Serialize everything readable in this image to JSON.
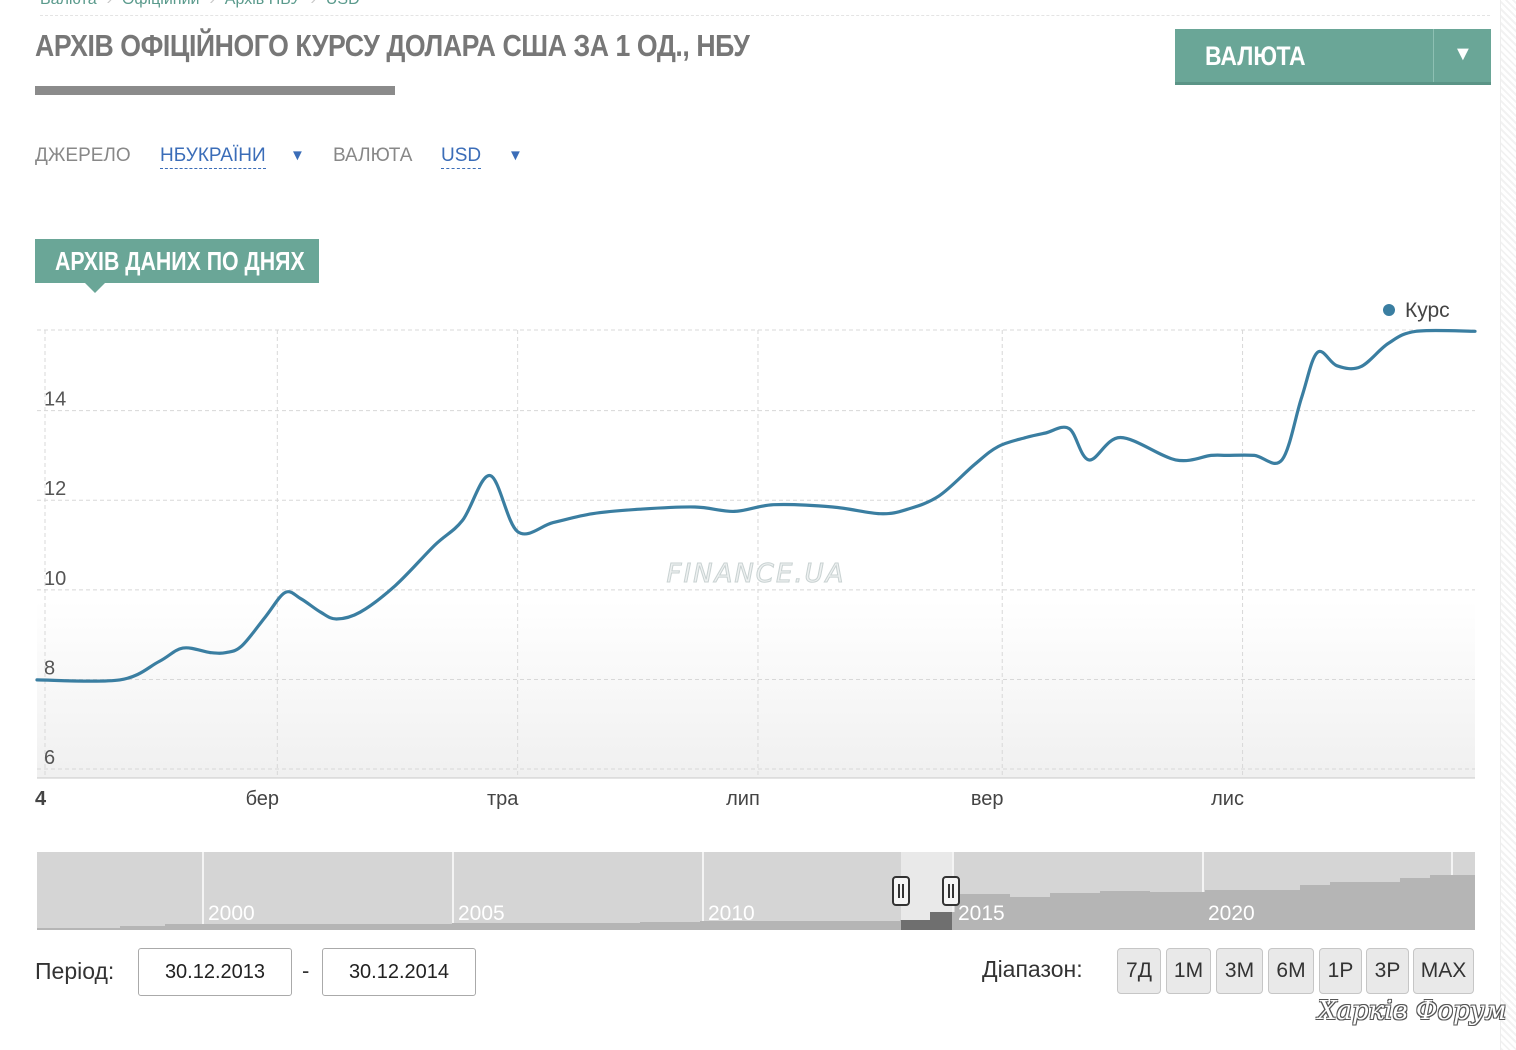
{
  "breadcrumbs": [
    "Валюта",
    "Офіційний",
    "Архів НБУ",
    "USD"
  ],
  "page_title": "АРХІВ ОФІЦІЙНОГО КУРСУ ДОЛАРА США ЗА 1 ОД., НБУ",
  "currency_dropdown": {
    "label": "ВАЛЮТА",
    "arrow": "▼"
  },
  "filters": {
    "source_label": "ДЖЕРЕЛО",
    "source_value": "НБУКРАЇНИ",
    "currency_label": "ВАЛЮТА",
    "currency_value": "USD",
    "arrow": "▼"
  },
  "tab_label": "АРХІВ ДАНИХ ПО ДНЯХ",
  "colors": {
    "accent": "#6aa697",
    "series": "#3a7ea1",
    "link": "#3b6db8"
  },
  "chart_data": {
    "type": "line",
    "watermark": "FINANCE.UA",
    "legend": {
      "entries": [
        "Курс"
      ],
      "placement": "top-right"
    },
    "grid": true,
    "ylim": [
      5.8,
      15.8
    ],
    "yticks": [
      6,
      8,
      10,
      12,
      14
    ],
    "xlim": [
      "2013-12-30",
      "2014-12-30"
    ],
    "xticks": [
      {
        "x": "2013-12-30",
        "label": "4"
      },
      {
        "x": "2014-03-01",
        "label": "бер"
      },
      {
        "x": "2014-05-01",
        "label": "тра"
      },
      {
        "x": "2014-07-01",
        "label": "лип"
      },
      {
        "x": "2014-09-01",
        "label": "вер"
      },
      {
        "x": "2014-11-01",
        "label": "лис"
      }
    ],
    "series": [
      {
        "name": "Курс",
        "x": [
          "2013-12-30",
          "2014-01-20",
          "2014-01-30",
          "2014-02-05",
          "2014-02-12",
          "2014-02-16",
          "2014-02-20",
          "2014-02-26",
          "2014-03-03",
          "2014-03-07",
          "2014-03-12",
          "2014-03-16",
          "2014-03-22",
          "2014-03-31",
          "2014-04-10",
          "2014-04-17",
          "2014-04-24",
          "2014-05-01",
          "2014-05-10",
          "2014-05-20",
          "2014-06-01",
          "2014-06-15",
          "2014-06-25",
          "2014-07-05",
          "2014-07-20",
          "2014-08-01",
          "2014-08-08",
          "2014-08-16",
          "2014-08-25",
          "2014-08-31",
          "2014-09-07",
          "2014-09-12",
          "2014-09-18",
          "2014-09-23",
          "2014-10-01",
          "2014-10-15",
          "2014-10-24",
          "2014-10-28",
          "2014-11-04",
          "2014-11-11",
          "2014-11-16",
          "2014-11-20",
          "2014-11-25",
          "2014-12-01",
          "2014-12-08",
          "2014-12-15",
          "2014-12-30"
        ],
        "values": [
          7.99,
          7.99,
          8.4,
          8.7,
          8.6,
          8.6,
          8.75,
          9.4,
          9.94,
          9.8,
          9.5,
          9.35,
          9.5,
          10.1,
          11.0,
          11.55,
          12.55,
          11.3,
          11.5,
          11.7,
          11.8,
          11.85,
          11.75,
          11.9,
          11.85,
          11.7,
          11.8,
          12.1,
          12.8,
          13.2,
          13.4,
          13.5,
          13.6,
          12.9,
          13.4,
          12.9,
          13.0,
          13.0,
          13.0,
          12.9,
          14.3,
          15.3,
          15.0,
          14.98,
          15.5,
          15.77,
          15.77
        ]
      }
    ]
  },
  "navigator": {
    "year_labels": [
      "2000",
      "2005",
      "2010",
      "2015",
      "2020"
    ],
    "selection": [
      "2013-12-30",
      "2014-12-30"
    ]
  },
  "period": {
    "label": "Період:",
    "from": "30.12.2013",
    "dash": "-",
    "to": "30.12.2014"
  },
  "range": {
    "label": "Діапазон:",
    "buttons": [
      "7Д",
      "1М",
      "3М",
      "6М",
      "1Р",
      "3Р",
      "MAX"
    ]
  },
  "site_watermark": "Харків Форум"
}
